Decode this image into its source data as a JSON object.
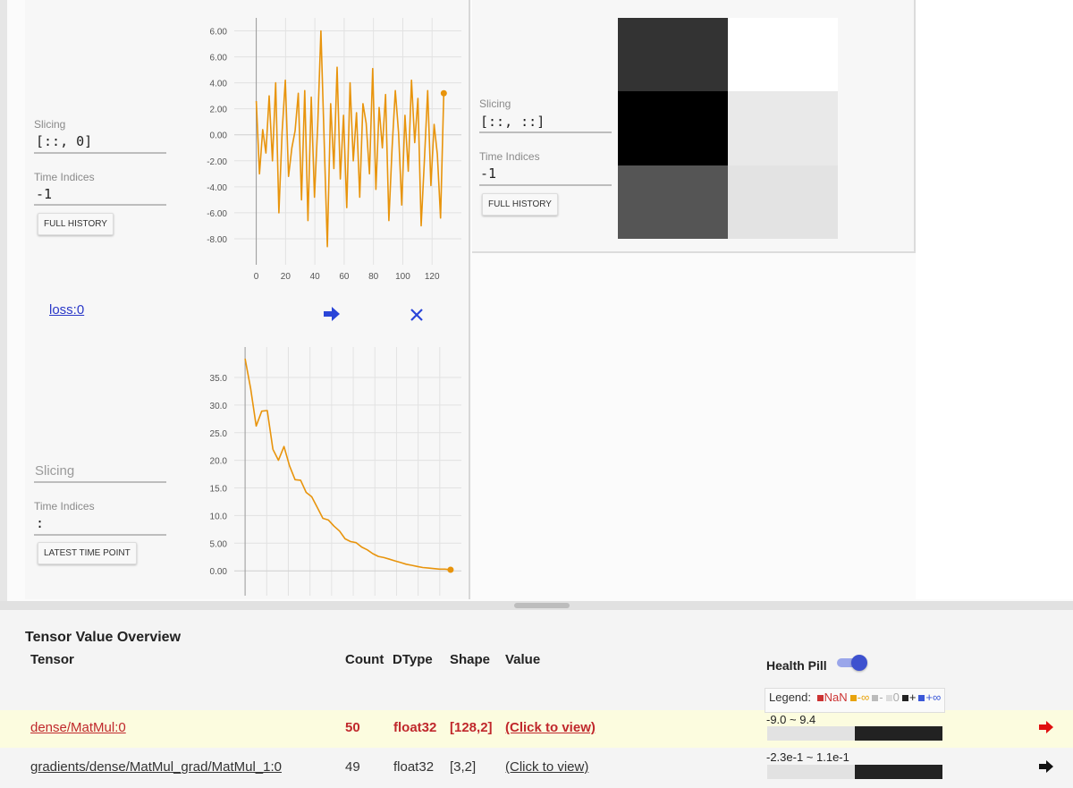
{
  "panels": {
    "top_left": {
      "slicing_label": "Slicing",
      "slicing_value": "[::, 0]",
      "time_indices_label": "Time Indices",
      "time_indices_value": "-1",
      "button": "FULL HISTORY"
    },
    "top_right": {
      "slicing_label": "Slicing",
      "slicing_value": "[::, ::]",
      "time_indices_label": "Time Indices",
      "time_indices_value": "-1",
      "button": "FULL HISTORY",
      "heatmap": {
        "rows": 3,
        "cols": 2,
        "colors": [
          "#333333",
          "#ffffff",
          "#000000",
          "#e9e9e9",
          "#555555",
          "#e3e3e3"
        ]
      }
    },
    "loss_row": {
      "tensor_link": "loss:0",
      "go_icon": "arrow-right-icon",
      "close_icon": "close-icon"
    },
    "bottom_left": {
      "slicing_label": "Slicing",
      "time_indices_label": "Time Indices",
      "time_indices_value": ":",
      "button": "LATEST TIME POINT"
    }
  },
  "chart_data": [
    {
      "type": "line",
      "title": "",
      "xlabel": "",
      "ylabel": "",
      "xlim": [
        -15,
        140
      ],
      "ylim": [
        -10,
        9
      ],
      "x_ticks": [
        "0",
        "20",
        "40",
        "60",
        "80",
        "100",
        "120"
      ],
      "y_ticks": [
        "6.00",
        "6.00",
        "4.00",
        "2.00",
        "0.00",
        "-2.00",
        "-4.00",
        "-6.00",
        "-8.00"
      ],
      "y_tick_values": [
        8,
        6,
        4,
        2,
        0,
        -2,
        -4,
        -6,
        -8
      ],
      "line_color": "#e8940c",
      "series": [
        {
          "values": [
            2.6,
            -3,
            0.4,
            -1.4,
            3,
            -2,
            4,
            -6,
            0.2,
            4.2,
            -3.2,
            -1,
            0.3,
            3.2,
            -5,
            3.4,
            -6.6,
            2.9,
            -4.8,
            0.7,
            8,
            -0.4,
            -8.6,
            2.4,
            -2.6,
            5.2,
            -3.4,
            1.5,
            -5.6,
            4,
            -2,
            1.7,
            -4.8,
            2.4,
            0.9,
            -3,
            5.1,
            -4.2,
            2.1,
            -1,
            3.1,
            -6.6,
            -1,
            3.4,
            0.2,
            -5.4,
            1.5,
            -2.8,
            4.2,
            -0.6,
            2.8,
            -7,
            -2,
            3.4,
            -3.9,
            0.8,
            -1.5,
            -6.4,
            3.2
          ]
        }
      ]
    },
    {
      "type": "line",
      "title": "",
      "xlabel": "",
      "ylabel": "",
      "xlim": [
        -5,
        100
      ],
      "ylim": [
        -4.5,
        40.5
      ],
      "y_ticks": [
        "35.0",
        "30.0",
        "25.0",
        "20.0",
        "15.0",
        "10.0",
        "5.00",
        "0.00"
      ],
      "y_tick_values": [
        35,
        30,
        25,
        20,
        15,
        10,
        5,
        0
      ],
      "line_color": "#e8940c",
      "series": [
        {
          "values": [
            38.4,
            33,
            26.2,
            28.9,
            29,
            22,
            20,
            22.5,
            19,
            16.5,
            16.4,
            14.2,
            13.4,
            11.5,
            9.5,
            9.2,
            8.1,
            7.2,
            5.8,
            5.3,
            5.1,
            4.3,
            3.8,
            3.1,
            2.6,
            2.4,
            2.1,
            1.8,
            1.5,
            1.2,
            1.0,
            0.8,
            0.6,
            0.5,
            0.4,
            0.3,
            0.3,
            0.2
          ]
        }
      ]
    }
  ],
  "overview": {
    "title": "Tensor Value Overview",
    "headers": {
      "tensor": "Tensor",
      "count": "Count",
      "dtype": "DType",
      "shape": "Shape",
      "value": "Value",
      "health_pill": "Health Pill"
    },
    "legend_label": "Legend:",
    "legend_items": [
      {
        "label": "NaN",
        "color": "#cc3333"
      },
      {
        "label": "-∞",
        "color": "#e8a30c"
      },
      {
        "label": "-",
        "color": "#bbbbbb"
      },
      {
        "label": "0",
        "color": "#dddddd"
      },
      {
        "label": "+",
        "color": "#222222"
      },
      {
        "label": "+∞",
        "color": "#3b58d8"
      }
    ],
    "rows": [
      {
        "tensor": "dense/MatMul:0",
        "count": "50",
        "dtype": "float32",
        "shape": "[128,2]",
        "value": "(Click to view)",
        "range": "-9.0 ~ 9.4",
        "arrow_icon": "arrow-right-icon",
        "highlight": true,
        "text_color": "#c0282c"
      },
      {
        "tensor": "gradients/dense/MatMul_grad/MatMul_1:0",
        "count": "49",
        "dtype": "float32",
        "shape": "[3,2]",
        "value": "(Click to view)",
        "range": "-2.3e-1 ~ 1.1e-1",
        "arrow_icon": "arrow-right-icon",
        "highlight": false,
        "text_color": "#333333"
      }
    ]
  }
}
